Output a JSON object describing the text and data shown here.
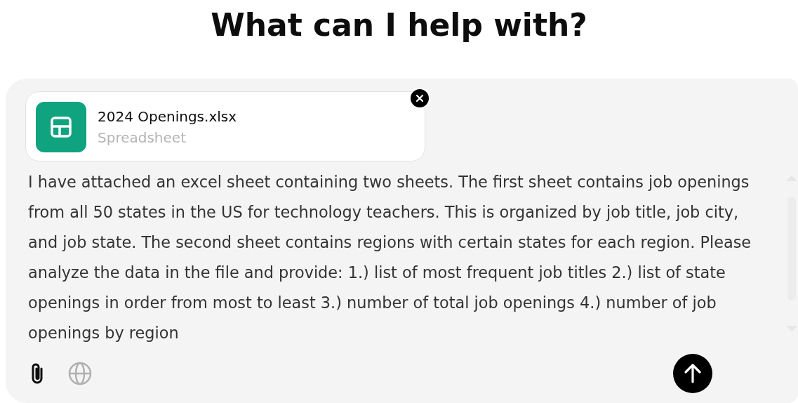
{
  "heading": "What can I help with?",
  "composer": {
    "attachment": {
      "name": "2024 Openings.xlsx",
      "type": "Spreadsheet"
    },
    "message": "I have attached an excel sheet containing two sheets. The first sheet contains job openings from all 50 states in the US for technology teachers. This is organized by job title, job city, and job state. The second sheet contains regions with certain states for each region. Please analyze the data in the file and provide: 1.) list of most frequent job titles 2.) list of state openings in order from most to least 3.) number of total job openings 4.) number of job openings by region",
    "tools": [
      {
        "kind": "attach",
        "active": true
      },
      {
        "kind": "web",
        "active": false
      }
    ]
  }
}
